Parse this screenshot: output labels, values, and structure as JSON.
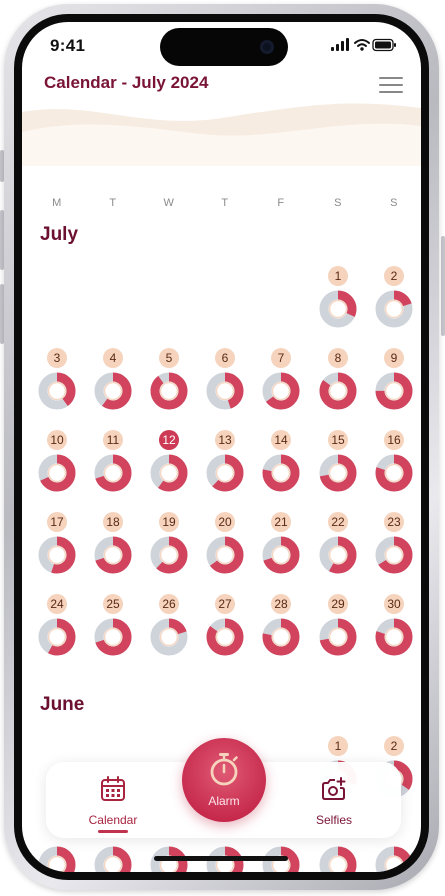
{
  "status_bar": {
    "time": "9:41"
  },
  "header": {
    "title": "Calendar - July 2024"
  },
  "weekdays": [
    "M",
    "T",
    "W",
    "T",
    "F",
    "S",
    "S"
  ],
  "colors": {
    "brand": "#7a1436",
    "accent": "#d2445d",
    "track": "#cfd3da",
    "badge": "#f6d3bc",
    "today": "#cc3a55"
  },
  "today": 12,
  "months": [
    {
      "name": "July",
      "days": [
        {
          "d": "1",
          "p": 0.32
        },
        {
          "d": "2",
          "p": 0.2
        },
        {
          "d": "3",
          "p": 0.4
        },
        {
          "d": "4",
          "p": 0.6
        },
        {
          "d": "5",
          "p": 0.9
        },
        {
          "d": "6",
          "p": 0.45
        },
        {
          "d": "7",
          "p": 0.65
        },
        {
          "d": "8",
          "p": 0.85
        },
        {
          "d": "9",
          "p": 0.75
        },
        {
          "d": "10",
          "p": 0.68
        },
        {
          "d": "11",
          "p": 0.7
        },
        {
          "d": "12",
          "p": 0.6
        },
        {
          "d": "13",
          "p": 0.62
        },
        {
          "d": "14",
          "p": 0.78
        },
        {
          "d": "15",
          "p": 0.72
        },
        {
          "d": "16",
          "p": 0.8
        },
        {
          "d": "17",
          "p": 0.55
        },
        {
          "d": "18",
          "p": 0.7
        },
        {
          "d": "19",
          "p": 0.62
        },
        {
          "d": "20",
          "p": 0.65
        },
        {
          "d": "21",
          "p": 0.7
        },
        {
          "d": "22",
          "p": 0.58
        },
        {
          "d": "23",
          "p": 0.66
        },
        {
          "d": "24",
          "p": 0.58
        },
        {
          "d": "25",
          "p": 0.7
        },
        {
          "d": "26",
          "p": 0.2
        },
        {
          "d": "27",
          "p": 0.85
        },
        {
          "d": "28",
          "p": 0.78
        },
        {
          "d": "29",
          "p": 0.72
        },
        {
          "d": "30",
          "p": 0.8
        }
      ]
    },
    {
      "name": "June",
      "days": [
        {
          "d": "1",
          "p": 0.3
        },
        {
          "d": "2",
          "p": 0.35
        }
      ]
    }
  ],
  "bottom_nav": {
    "calendar_label": "Calendar",
    "alarm_label": "Alarm",
    "selfies_label": "Selfies"
  }
}
